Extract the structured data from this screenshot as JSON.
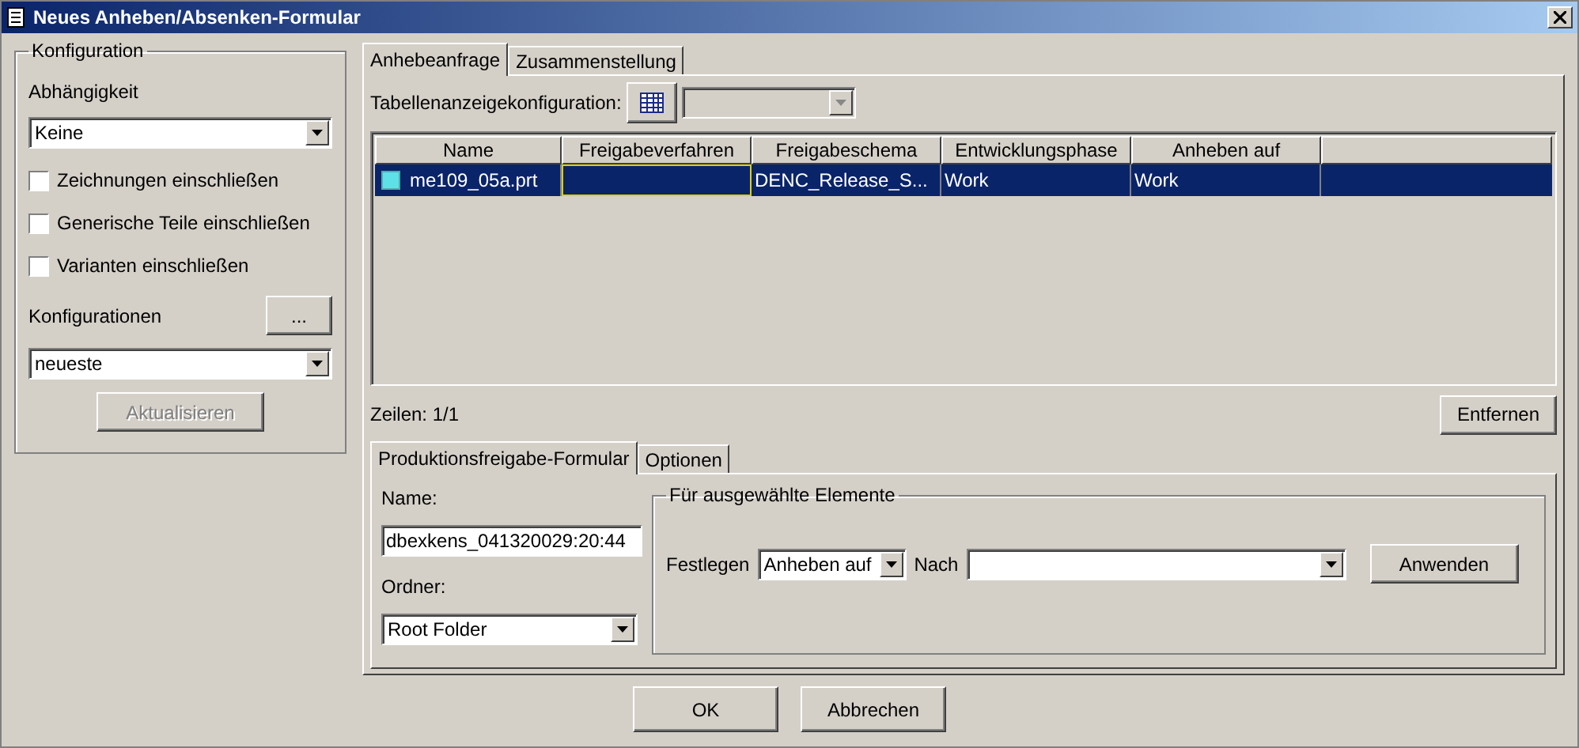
{
  "window": {
    "title": "Neues Anheben/Absenken-Formular"
  },
  "config": {
    "title": "Konfiguration",
    "dependency_label": "Abhängigkeit",
    "dependency_value": "Keine",
    "checkboxes": [
      {
        "label": "Zeichnungen einschließen",
        "checked": false
      },
      {
        "label": "Generische Teile einschließen",
        "checked": false
      },
      {
        "label": "Varianten einschließen",
        "checked": false
      }
    ],
    "configurations_label": "Konfigurationen",
    "browse_button": "...",
    "configuration_value": "neueste",
    "update_button": {
      "label": "Aktualisieren",
      "disabled": true
    }
  },
  "tabs": [
    {
      "label": "Anhebeanfrage",
      "selected": true
    },
    {
      "label": "Zusammenstellung",
      "selected": false
    }
  ],
  "table_config_label": "Tabellenanzeigekonfiguration:",
  "table": {
    "columns": [
      "Name",
      "Freigabeverfahren",
      "Freigabeschema",
      "Entwicklungsphase",
      "Anheben auf"
    ],
    "rows": [
      {
        "selected": true,
        "cells": [
          "me109_05a.prt",
          "",
          "DENC_Release_S...",
          "Work",
          "Work"
        ]
      }
    ]
  },
  "row_count": "Zeilen: 1/1",
  "remove_button": "Entfernen",
  "subtabs": [
    {
      "label": "Produktionsfreigabe-Formular",
      "selected": true
    },
    {
      "label": "Optionen",
      "selected": false
    }
  ],
  "form": {
    "name_label": "Name:",
    "name_value": "dbexkens_041320029:20:44",
    "folder_label": "Ordner:",
    "folder_value": "Root Folder",
    "group_title": "Für ausgewählte Elemente",
    "set_label": "Festlegen",
    "set_value": "Anheben auf",
    "to_label": "Nach",
    "apply_button": "Anwenden"
  },
  "buttons": [
    "OK",
    "Abbrechen"
  ]
}
